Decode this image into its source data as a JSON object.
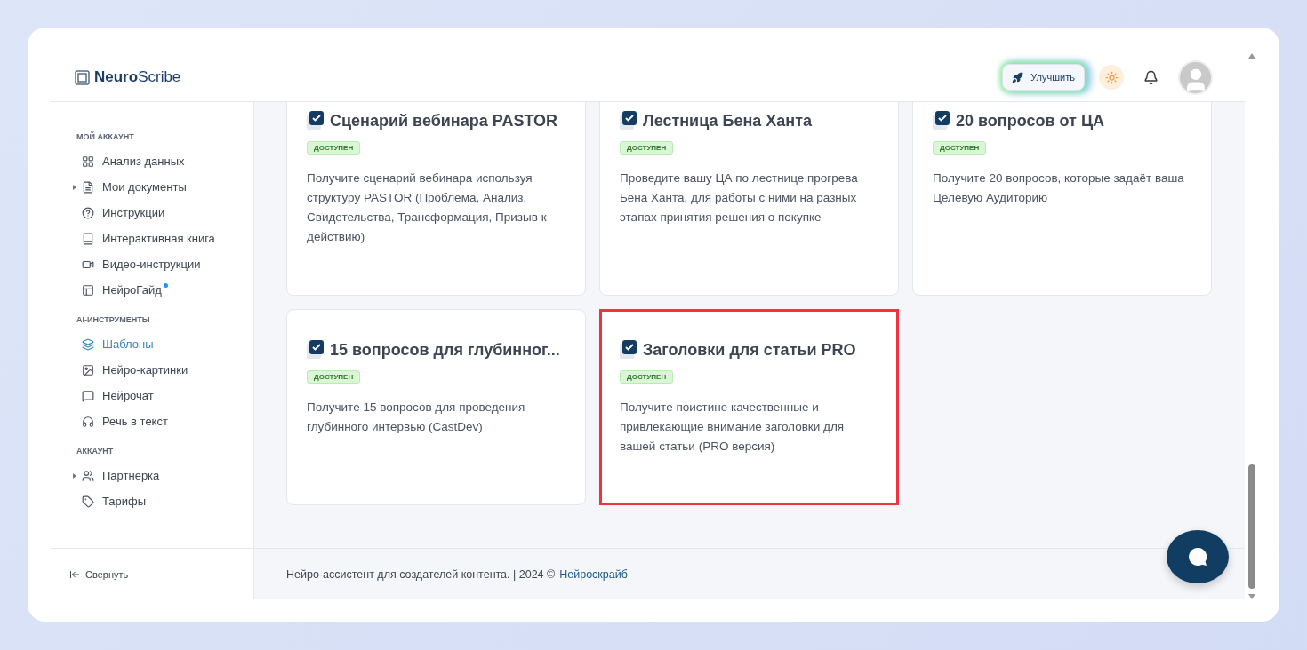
{
  "header": {
    "logo": "**Neuro**Scribe",
    "upgrade_button": "Улучшить"
  },
  "sidebar": {
    "sections": [
      {
        "title": "МОЙ АККАУНТ",
        "items": [
          {
            "label": "Анализ данных",
            "selected": false,
            "expandable": false,
            "dot": false
          },
          {
            "label": "Мои документы",
            "selected": false,
            "expandable": true,
            "dot": false
          },
          {
            "label": "Инструкции",
            "selected": false,
            "expandable": false,
            "dot": false
          },
          {
            "label": "Интерактивная книга",
            "selected": false,
            "expandable": false,
            "dot": false
          },
          {
            "label": "Видео-инструкции",
            "selected": false,
            "expandable": false,
            "dot": false
          },
          {
            "label": "НейроГайд",
            "selected": false,
            "expandable": false,
            "dot": true
          }
        ]
      },
      {
        "title": "AI-ИНСТРУМЕНТЫ",
        "items": [
          {
            "label": "Шаблоны",
            "selected": true,
            "expandable": false,
            "dot": false
          },
          {
            "label": "Нейро-картинки",
            "selected": false,
            "expandable": false,
            "dot": false
          },
          {
            "label": "Нейрочат",
            "selected": false,
            "expandable": false,
            "dot": false
          },
          {
            "label": "Речь в текст",
            "selected": false,
            "expandable": false,
            "dot": false
          }
        ]
      },
      {
        "title": "АККАУНТ",
        "items": [
          {
            "label": "Партнерка",
            "selected": false,
            "expandable": true,
            "dot": false
          },
          {
            "label": "Тарифы",
            "selected": false,
            "expandable": false,
            "dot": false
          }
        ]
      }
    ],
    "collapse": "Свернуть"
  },
  "templates": [
    {
      "title": "Сценарий вебинара PASTOR",
      "badge": "ДОСТУПЕН",
      "description": "Получите сценарий вебинара используя структуру PASTOR (Проблема, Анализ, Свидетельства, Трансформация, Призыв к действию)",
      "selected": false
    },
    {
      "title": "Лестница Бена Ханта",
      "badge": "ДОСТУПЕН",
      "description": "Проведите вашу ЦА по лестнице прогрева Бена Ханта, для работы с ними на разных этапах принятия решения о покупке",
      "selected": false
    },
    {
      "title": "20 вопросов от ЦА",
      "badge": "ДОСТУПЕН",
      "description": "Получите 20 вопросов, которые задаёт ваша Целевую Аудиторию",
      "selected": false
    },
    {
      "title": "15 вопросов для глубинног...",
      "badge": "ДОСТУПЕН",
      "description": "Получите 15 вопросов для проведения глубинного интервью (CastDev)",
      "selected": false
    },
    {
      "title": "Заголовки для статьи PRO",
      "badge": "ДОСТУПЕН",
      "description": "Получите поистине качественные и привлекающие внимание заголовки для вашей статьи (PRO версия)",
      "selected": true
    }
  ],
  "footer": {
    "text": "Нейро-ассистент для создателей контента.  | 2024 ©",
    "link": "Нейроскрайб"
  }
}
